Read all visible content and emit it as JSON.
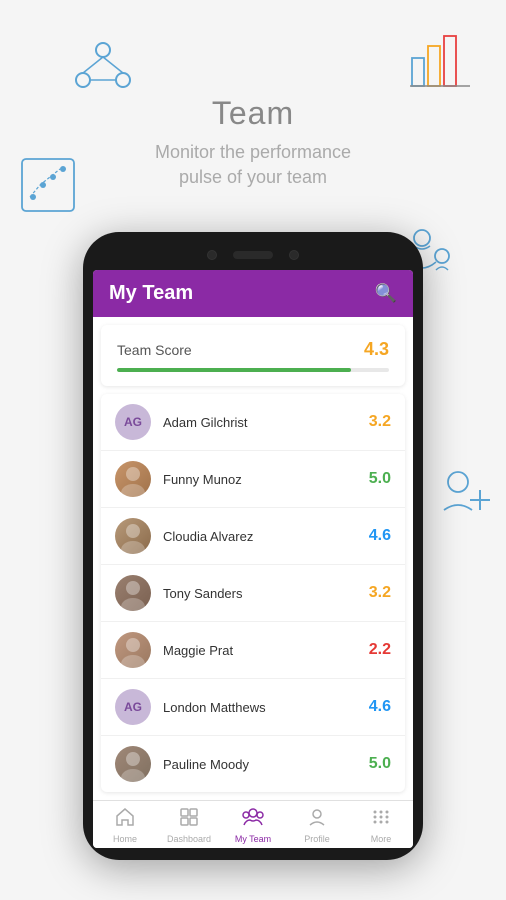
{
  "page": {
    "title": "Team",
    "subtitle": "Monitor the performance\npulse of your team"
  },
  "app": {
    "header_title": "My Team",
    "search_label": "Search"
  },
  "score_card": {
    "label": "Team Score",
    "value": "4.3",
    "bar_percent": 86
  },
  "team_members": [
    {
      "id": 1,
      "name": "Adam Gilchrist",
      "score": "3.2",
      "score_color": "orange",
      "avatar_type": "initials",
      "initials": "AG"
    },
    {
      "id": 2,
      "name": "Funny Munoz",
      "score": "5.0",
      "score_color": "green",
      "avatar_type": "photo",
      "photo_class": "photo-funny"
    },
    {
      "id": 3,
      "name": "Cloudia Alvarez",
      "score": "4.6",
      "score_color": "blue",
      "avatar_type": "photo",
      "photo_class": "photo-cloudia"
    },
    {
      "id": 4,
      "name": "Tony Sanders",
      "score": "3.2",
      "score_color": "orange",
      "avatar_type": "photo",
      "photo_class": "photo-tony"
    },
    {
      "id": 5,
      "name": "Maggie Prat",
      "score": "2.2",
      "score_color": "red",
      "avatar_type": "photo",
      "photo_class": "photo-maggie"
    },
    {
      "id": 6,
      "name": "London Matthews",
      "score": "4.6",
      "score_color": "blue",
      "avatar_type": "initials",
      "initials": "AG"
    },
    {
      "id": 7,
      "name": "Pauline Moody",
      "score": "5.0",
      "score_color": "green",
      "avatar_type": "photo",
      "photo_class": "photo-pauline"
    }
  ],
  "bottom_nav": [
    {
      "id": "home",
      "label": "Home",
      "icon": "⌂",
      "active": false
    },
    {
      "id": "dashboard",
      "label": "Dashboard",
      "icon": "▦",
      "active": false
    },
    {
      "id": "myteam",
      "label": "My Team",
      "icon": "👥",
      "active": true
    },
    {
      "id": "profile",
      "label": "Profile",
      "icon": "👤",
      "active": false
    },
    {
      "id": "more",
      "label": "More",
      "icon": "⋯",
      "active": false
    }
  ],
  "colors": {
    "purple": "#8b2aa5",
    "orange": "#f5a623",
    "green": "#4caf50",
    "blue": "#2196f3",
    "red": "#e53935"
  }
}
